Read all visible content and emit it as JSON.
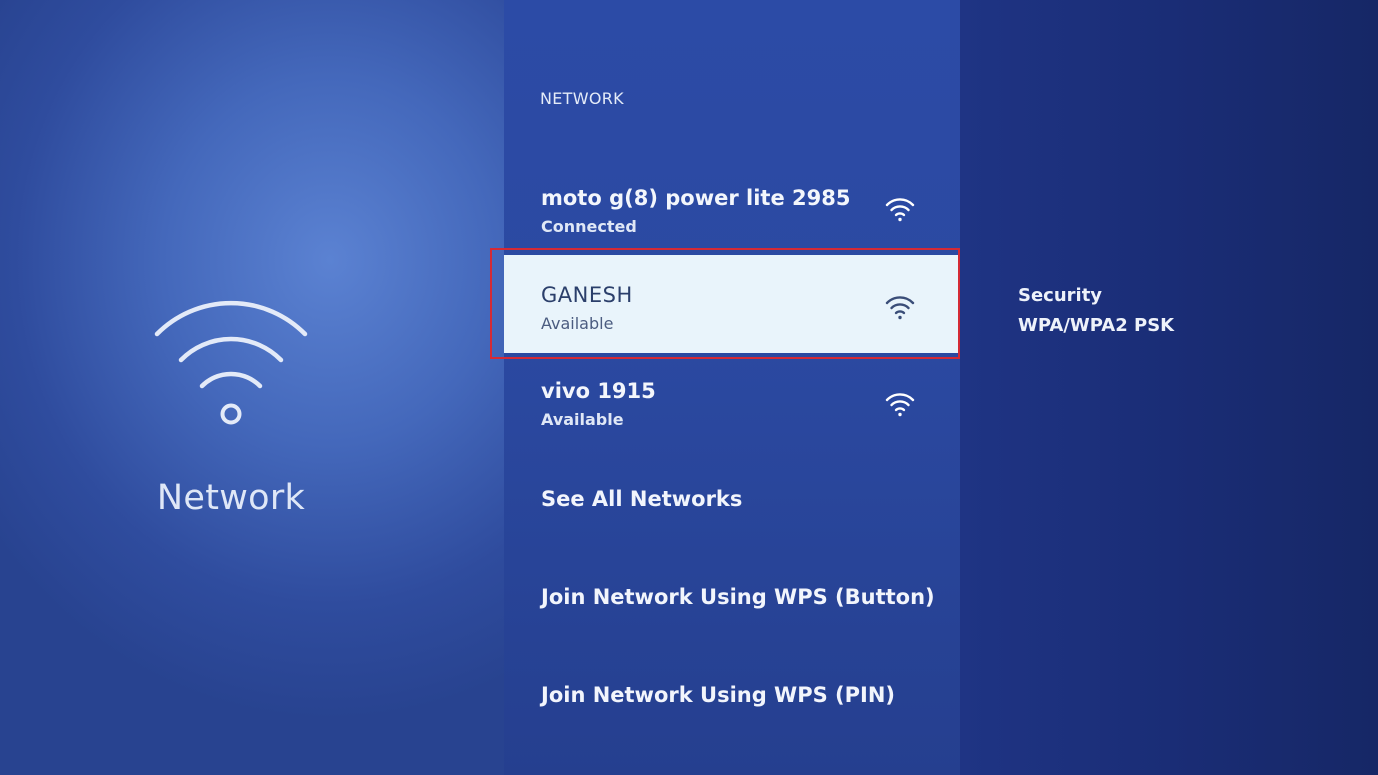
{
  "category": {
    "icon": "wifi-icon",
    "title": "Network"
  },
  "section": {
    "title": "NETWORK"
  },
  "networks": [
    {
      "name": "moto g(8) power lite 2985",
      "status": "Connected",
      "icon": "wifi-signal-icon"
    },
    {
      "name": "GANESH",
      "status": "Available",
      "icon": "wifi-signal-icon",
      "selected": true
    },
    {
      "name": "vivo 1915",
      "status": "Available",
      "icon": "wifi-signal-icon"
    }
  ],
  "actions": {
    "see_all": "See All Networks",
    "wps_button": "Join Network Using WPS (Button)",
    "wps_pin": "Join Network Using WPS (PIN)"
  },
  "details": {
    "security_label": "Security",
    "security_value": "WPA/WPA2 PSK"
  },
  "colors": {
    "focus_outline": "#d42a35",
    "selected_background": "#e9f4fb"
  }
}
